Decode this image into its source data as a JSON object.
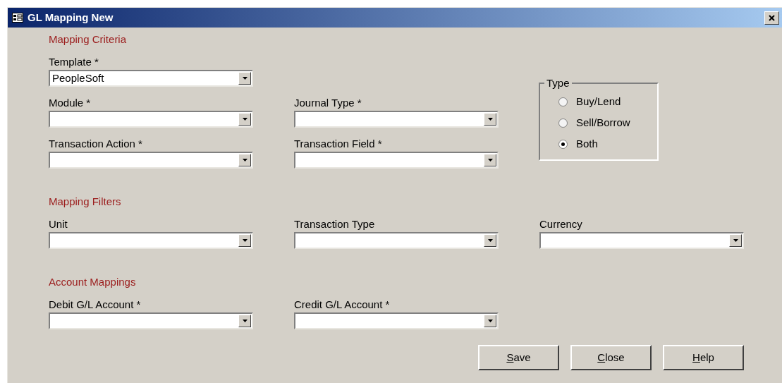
{
  "window": {
    "title": "GL Mapping New"
  },
  "sections": [
    {
      "heading": "Mapping Criteria",
      "rows": [
        [
          {
            "label": "Template *",
            "value": "PeopleSoft"
          }
        ],
        [
          {
            "label": "Module *"
          },
          {
            "label": "Journal Type *"
          }
        ],
        [
          {
            "label": "Transaction Action *"
          },
          {
            "label": "Transaction Field *"
          }
        ]
      ],
      "type_group": {
        "legend": "Type",
        "options": [
          {
            "label": "Buy/Lend",
            "selected": false
          },
          {
            "label": "Sell/Borrow",
            "selected": false
          },
          {
            "label": "Both",
            "selected": true
          }
        ]
      }
    },
    {
      "heading": "Mapping Filters",
      "rows": [
        [
          {
            "label": "Unit"
          },
          {
            "label": "Transaction Type"
          },
          {
            "label": "Currency"
          }
        ]
      ]
    },
    {
      "heading": "Account Mappings",
      "rows": [
        [
          {
            "label": "Debit G/L Account *"
          },
          {
            "label": "Credit G/L Account *"
          }
        ]
      ]
    }
  ],
  "buttons": [
    "Save",
    "Close",
    "Help"
  ]
}
